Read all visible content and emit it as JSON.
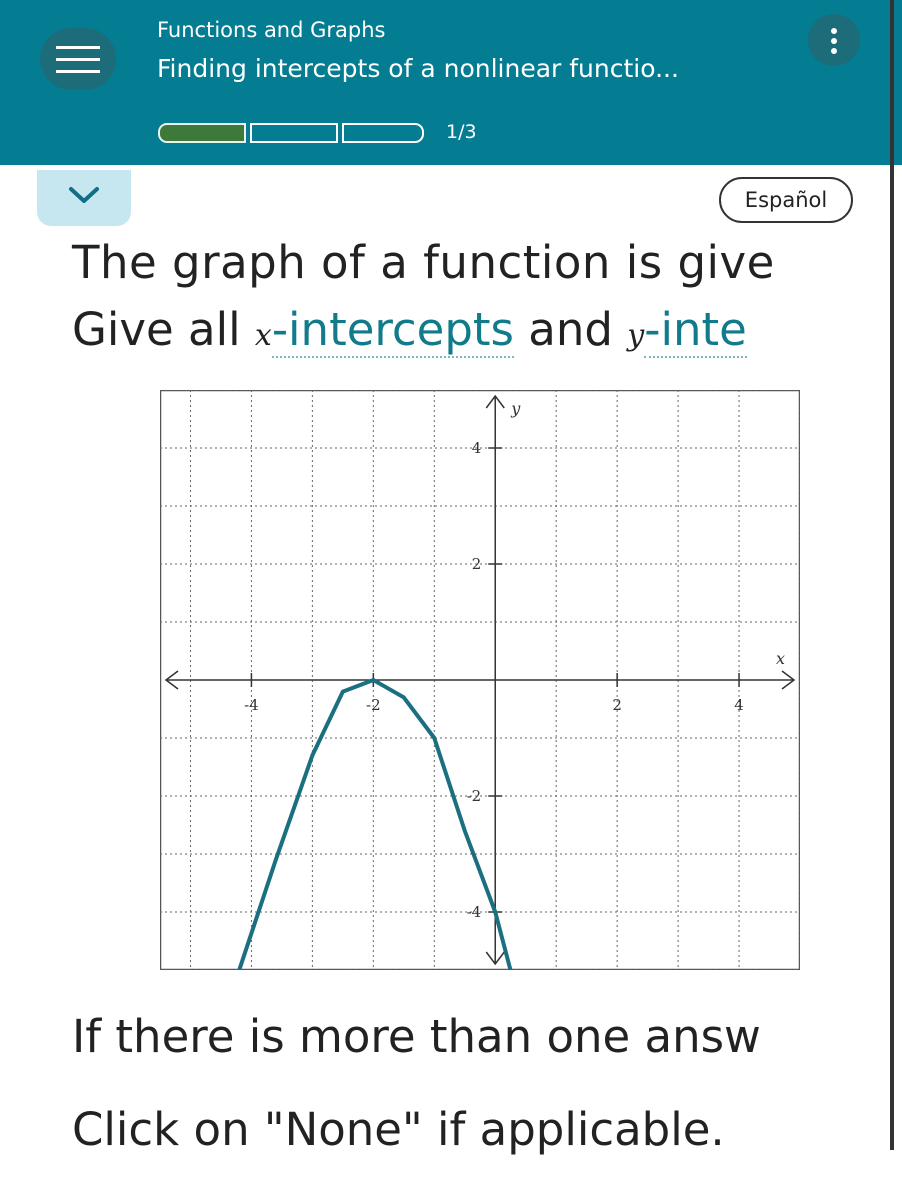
{
  "header": {
    "topic": "Functions and Graphs",
    "title": "Finding intercepts of a nonlinear functio...",
    "progress_text": "1/3",
    "progress_fraction": 0.333,
    "accent_color": "#047d93",
    "progress_color": "#3d7a3a"
  },
  "controls": {
    "menu_icon": "hamburger-icon",
    "more_icon": "kebab-icon",
    "collapse_icon": "chevron-down-icon",
    "language_label": "Español"
  },
  "question": {
    "line1": "The graph of a function is give",
    "line2_start": "Give all ",
    "x_var": "x",
    "term1": "-intercepts",
    "and_text": " and ",
    "y_var": "y",
    "term2": "-inte"
  },
  "instructions": {
    "line3": "If there is more than one answ",
    "line4": "Click on \"None\" if applicable."
  },
  "chart_data": {
    "type": "line",
    "x_label": "x",
    "y_label": "y",
    "xlim": [
      -5.5,
      5
    ],
    "ylim": [
      -5,
      5
    ],
    "x_ticks": [
      -4,
      -2,
      2,
      4
    ],
    "x_tick_labels": [
      "-4",
      "-2",
      "2",
      "4"
    ],
    "y_ticks": [
      4,
      2,
      -2,
      -4
    ],
    "y_tick_labels": [
      "4",
      "2",
      "-2",
      "-4"
    ],
    "grid": true,
    "series": [
      {
        "color": "#1a6f80",
        "points": [
          [
            -4.2,
            -5
          ],
          [
            -3.6,
            -3.1
          ],
          [
            -3,
            -1.3
          ],
          [
            -2.5,
            -0.2
          ],
          [
            -2,
            0
          ],
          [
            -1.5,
            -0.3
          ],
          [
            -1,
            -1
          ],
          [
            -0.5,
            -2.6
          ],
          [
            0,
            -4.0
          ],
          [
            0.25,
            -5
          ]
        ]
      }
    ]
  }
}
